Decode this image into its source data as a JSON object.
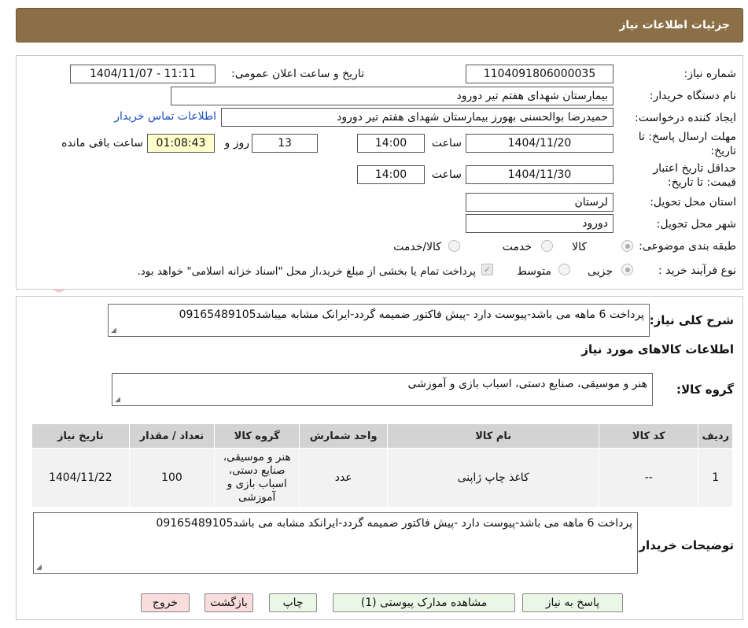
{
  "header": {
    "title": "جزئیات اطلاعات نیاز"
  },
  "form": {
    "need_number_label": "شماره نیاز:",
    "need_number": "1104091806000035",
    "announce_label": "تاریخ و ساعت اعلان عمومی:",
    "announce_value": "1404/11/07 - 11:11",
    "buyer_org_label": "نام دستگاه خریدار:",
    "buyer_org": "بیمارستان شهدای هفتم تیر دورود",
    "creator_label": "ایجاد کننده درخواست:",
    "creator": "حمیدرضا بوالحسنی بهورز بیمارستان شهدای هفتم تیر دورود",
    "contact_link": "اطلاعات تماس خریدار",
    "deadline_label_1": "مهلت ارسال پاسخ: تا",
    "deadline_label_2": "تاریخ:",
    "deadline_date": "1404/11/20",
    "time_label": "ساعت",
    "deadline_time": "14:00",
    "days_value": "13",
    "days_label": "روز و",
    "remaining_time": "01:08:43",
    "remaining_label": "ساعت باقی مانده",
    "validity_label_1": "حداقل تاریخ اعتبار",
    "validity_label_2": "قیمت: تا تاریخ:",
    "validity_date": "1404/11/30",
    "validity_time": "14:00",
    "province_label": "استان محل تحویل:",
    "province": "لرستان",
    "city_label": "شهر محل تحویل:",
    "city": "دورود",
    "category_label": "طبقه بندی موضوعی:",
    "category_options": [
      "کالا",
      "خدمت",
      "کالا/خدمت"
    ],
    "process_label": "نوع فرآیند خرید :",
    "process_options": [
      "جزیی",
      "متوسط"
    ],
    "payment_note": "پرداخت تمام یا بخشی از مبلغ خرید،از محل \"اسناد خزانه اسلامی\" خواهد بود."
  },
  "description": {
    "label": "شرح کلی نیاز:",
    "text": "پرداخت 6 ماهه می باشد-پیوست دارد -پیش فاکتور ضمیمه گردد-ایرانک مشابه میباشد09165489105"
  },
  "goods": {
    "section_title": "اطلاعات کالاهای مورد نیاز",
    "group_label": "گروه کالا:",
    "group_value": "هنر و موسیقی، صنایع دستی، اسباب بازی و آموزشی"
  },
  "table": {
    "headers": [
      "ردیف",
      "کد کالا",
      "نام کالا",
      "واحد شمارش",
      "گروه کالا",
      "تعداد / مقدار",
      "تاریخ نیاز"
    ],
    "row": {
      "index": "1",
      "code": "--",
      "name": "کاغذ چاپ ژاپنی",
      "unit": "عدد",
      "group": "هنر و موسیقی، صنایع دستی، اسباب بازی و آموزشی",
      "qty": "100",
      "date": "1404/11/22"
    }
  },
  "buyer_notes": {
    "label": "توضیحات خریدار:",
    "text": "پرداخت 6 ماهه می باشد-پیوست دارد -پیش فاکتور ضمیمه گردد-ایرانکد مشابه می باشد09165489105"
  },
  "buttons": {
    "reply": "پاسخ به نیاز",
    "attachments": "مشاهده مدارک پیوستی (1)",
    "print": "چاپ",
    "back": "بازگشت",
    "exit": "خروج"
  },
  "watermark": {
    "text": "AriaTender.neT"
  },
  "colors": {
    "header_bg": "#8b6f47",
    "remaining_bg": "#ffffcc",
    "link": "#1a4fbf"
  }
}
